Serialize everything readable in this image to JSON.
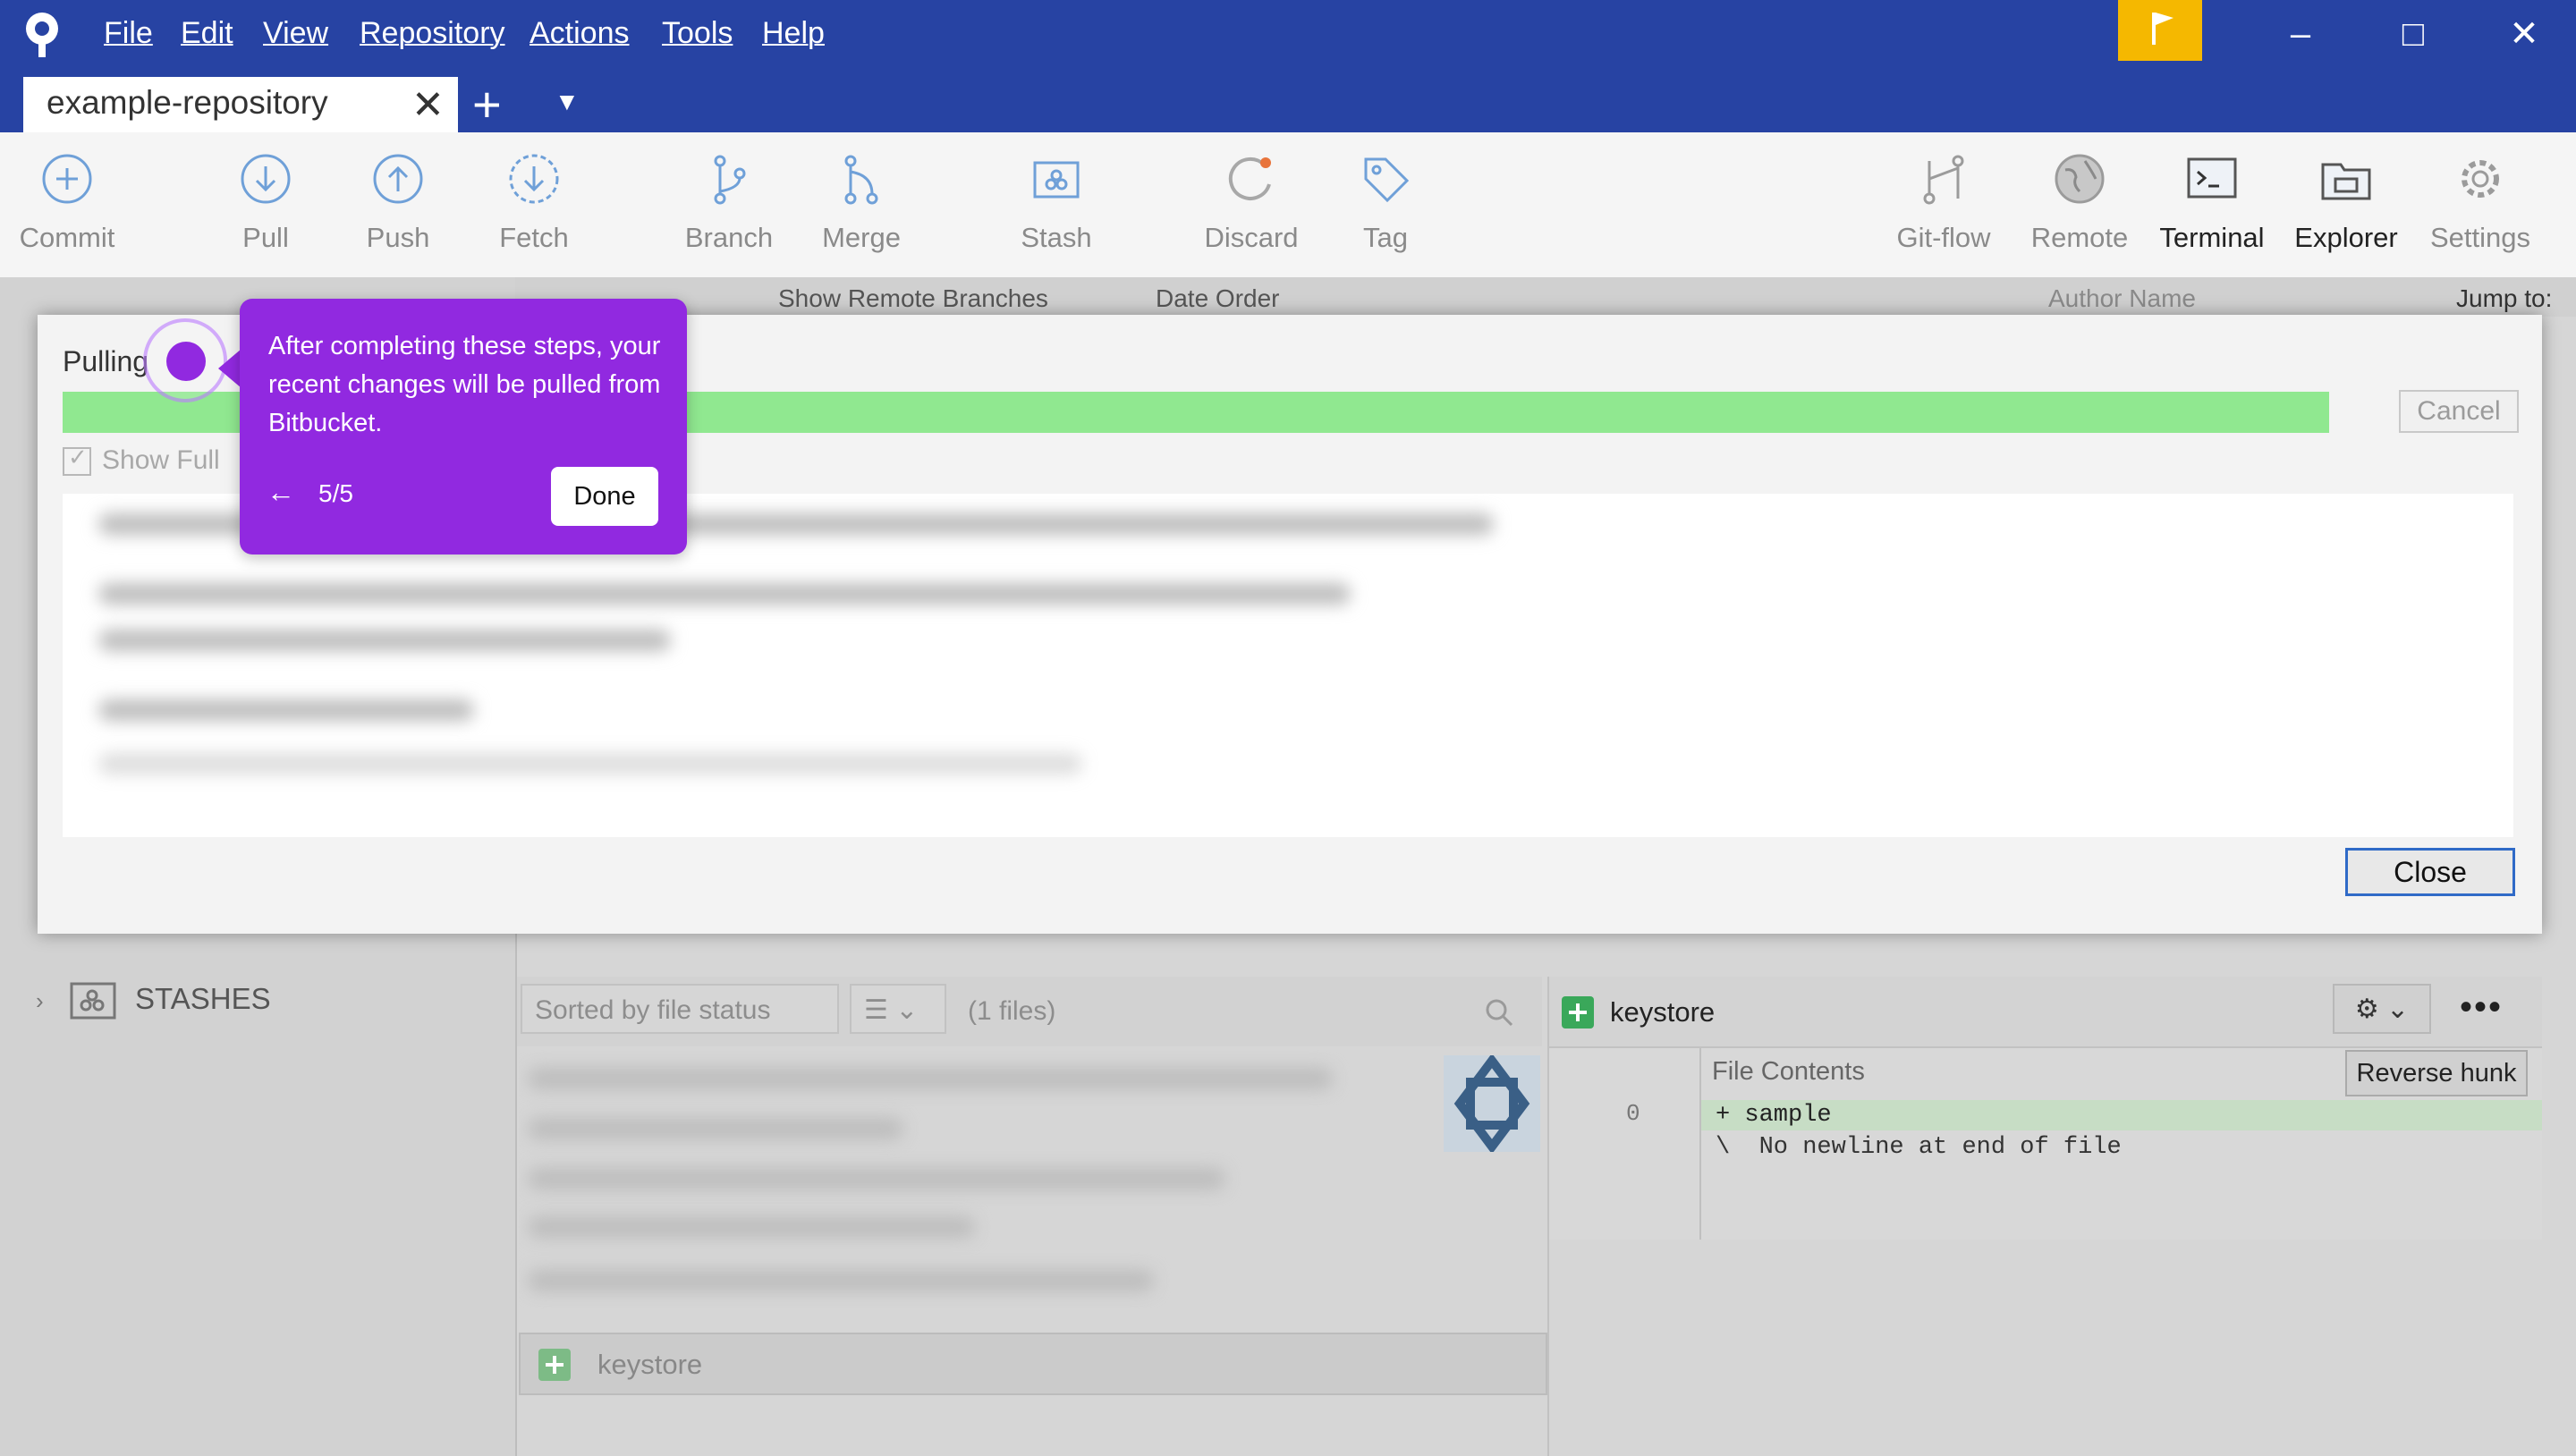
{
  "menu": [
    "File",
    "Edit",
    "View",
    "Repository",
    "Actions",
    "Tools",
    "Help"
  ],
  "tab": {
    "label": "example-repository"
  },
  "toolbar": {
    "commit": "Commit",
    "pull": "Pull",
    "push": "Push",
    "fetch": "Fetch",
    "branch": "Branch",
    "merge": "Merge",
    "stash": "Stash",
    "discard": "Discard",
    "tag": "Tag",
    "gitflow": "Git-flow",
    "remote": "Remote",
    "terminal": "Terminal",
    "explorer": "Explorer",
    "settings": "Settings"
  },
  "background": {
    "show_remote_branches": "Show Remote Branches",
    "date_order": "Date Order",
    "author_placeholder": "Author Name",
    "jump_to": "Jump to:",
    "stashes": "STASHES",
    "sort_by": "Sorted by file status",
    "file_count": "(1 files)",
    "file_name": "keystore"
  },
  "dialog": {
    "title": "Pulling",
    "progress": 1.0,
    "cancel": "Cancel",
    "show_full": "Show Full",
    "close": "Close"
  },
  "diff": {
    "file_name": "keystore",
    "file_contents": "File Contents",
    "reverse_hunk": "Reverse hunk",
    "line_number": "0",
    "line1": "+ sample",
    "line2": "\\  No newline at end of file"
  },
  "tooltip": {
    "text": "After completing these steps, your recent changes will be pulled from Bitbucket.",
    "step": "5/5",
    "done": "Done"
  },
  "colors": {
    "titlebar": "#2743a3",
    "accent": "#9129e0",
    "progress": "#90e890",
    "flag": "#f5b800"
  }
}
